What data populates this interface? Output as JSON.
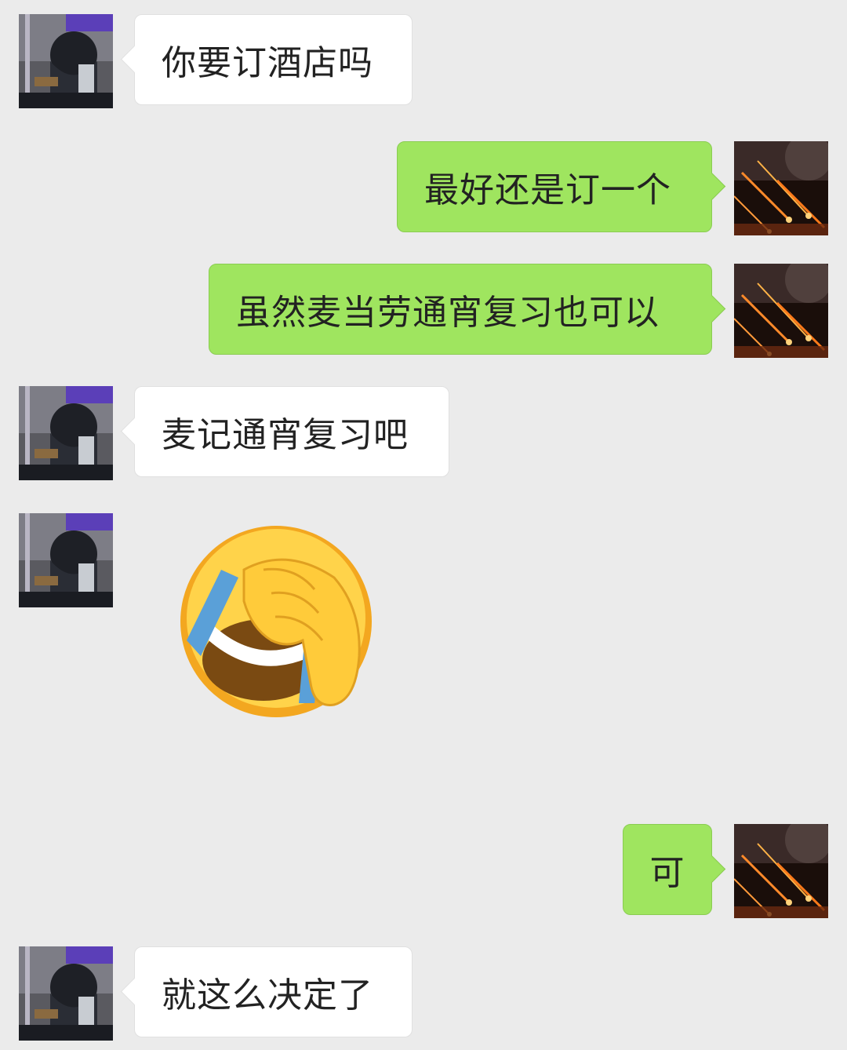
{
  "chat": {
    "messages": [
      {
        "side": "left",
        "type": "text",
        "text": "你要订酒店吗"
      },
      {
        "side": "right",
        "type": "text",
        "text": "最好还是订一个"
      },
      {
        "side": "right",
        "type": "text",
        "text": "虽然麦当劳通宵复习也可以"
      },
      {
        "side": "left",
        "type": "text",
        "text": "麦记通宵复习吧"
      },
      {
        "side": "left",
        "type": "emoji",
        "emoji": "facepalm-laugh-emoji"
      },
      {
        "side": "right",
        "type": "text",
        "text": "可"
      },
      {
        "side": "left",
        "type": "text",
        "text": "就这么决定了"
      }
    ]
  },
  "colors": {
    "background": "#ebebeb",
    "incoming_bubble": "#ffffff",
    "outgoing_bubble": "#9fe55f"
  }
}
